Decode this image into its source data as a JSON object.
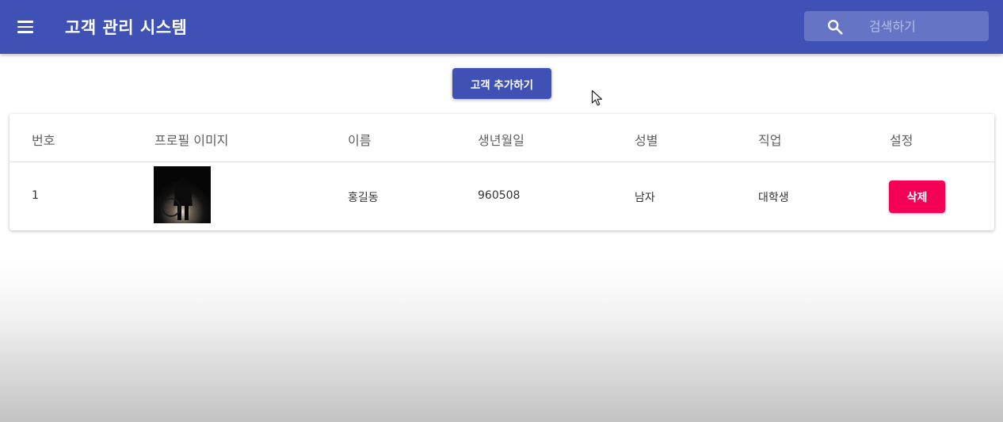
{
  "colors": {
    "primary": "#3f51b5",
    "secondary": "#f50057",
    "search_bg": "#6574c4"
  },
  "appbar": {
    "title": "고객 관리 시스템",
    "menu_icon": "menu-icon",
    "search": {
      "icon": "search-icon",
      "placeholder": "검색하기",
      "value": ""
    }
  },
  "actions": {
    "add_customer_label": "고객 추가하기"
  },
  "table": {
    "headers": [
      "번호",
      "프로필 이미지",
      "이름",
      "생년월일",
      "성별",
      "직업",
      "설정"
    ],
    "rows": [
      {
        "id": "1",
        "image": "profile-photo",
        "name": "홍길동",
        "birthday": "960508",
        "gender": "남자",
        "job": "대학생",
        "action_label": "삭제"
      }
    ]
  }
}
